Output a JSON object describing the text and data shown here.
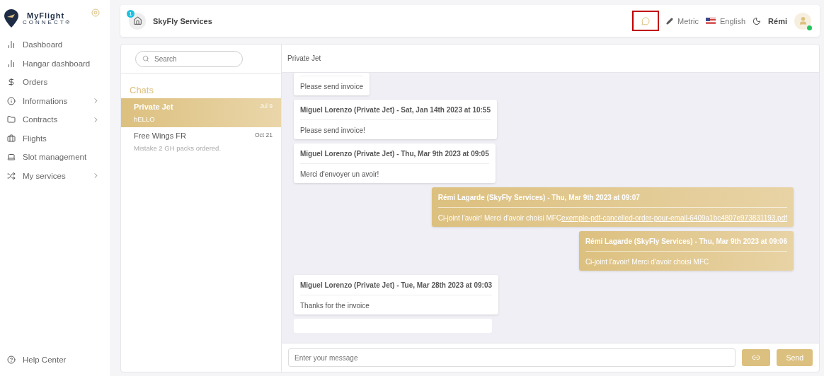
{
  "brand": {
    "name": "MyFlight",
    "sub": "CONNECT®"
  },
  "nav": [
    {
      "label": "Dashboard",
      "kind": "bars",
      "expandable": false
    },
    {
      "label": "Hangar dashboard",
      "kind": "bars",
      "expandable": false
    },
    {
      "label": "Orders",
      "kind": "dollar",
      "expandable": false
    },
    {
      "label": "Informations",
      "kind": "info",
      "expandable": true
    },
    {
      "label": "Contracts",
      "kind": "folder",
      "expandable": true
    },
    {
      "label": "Flights",
      "kind": "luggage",
      "expandable": false
    },
    {
      "label": "Slot management",
      "kind": "laptop",
      "expandable": false
    },
    {
      "label": "My services",
      "kind": "shuffle",
      "expandable": true
    }
  ],
  "help": {
    "label": "Help Center"
  },
  "header": {
    "company": "SkyFly Services",
    "badge": "1",
    "chat_highlighted": true,
    "units": "Metric",
    "language": "English",
    "user": "Rémi",
    "online": true
  },
  "search": {
    "placeholder": "Search"
  },
  "chats_title": "Chats",
  "chats": [
    {
      "name": "Private Jet",
      "preview": "hELLO",
      "date": "Jul 9",
      "selected": true
    },
    {
      "name": "Free Wings FR",
      "preview": "Mistake 2 GH packs ordered.",
      "date": "Oct 21",
      "selected": false
    }
  ],
  "conversation": {
    "title": "Private Jet"
  },
  "messages": [
    {
      "mine": false,
      "body": "Please send invoice"
    },
    {
      "mine": false,
      "header": "Miguel Lorenzo (Private Jet) - Sat, Jan 14th 2023 at 10:55",
      "body": "Please send invoice!"
    },
    {
      "mine": false,
      "header": "Miguel Lorenzo (Private Jet) - Thu, Mar 9th 2023 at 09:05",
      "body": "Merci d'envoyer un avoir!"
    },
    {
      "mine": true,
      "header": "Rémi Lagarde (SkyFly Services) - Thu, Mar 9th 2023 at 09:07",
      "body": "Ci-joint l'avoir! Merci d'avoir choisi MFC",
      "link": "exemple-pdf-cancelled-order-pour-email-6409a1bc4807e973831193.pdf"
    },
    {
      "mine": true,
      "header": "Rémi Lagarde (SkyFly Services) - Thu, Mar 9th 2023 at 09:06",
      "body": "Ci-joint l'avoir! Merci d'avoir choisi MFC"
    },
    {
      "mine": false,
      "header": "Miguel Lorenzo (Private Jet) - Tue, Mar 28th 2023 at 09:03",
      "body": "Thanks for the invoice"
    }
  ],
  "composer": {
    "placeholder": "Enter your message",
    "send": "Send"
  }
}
